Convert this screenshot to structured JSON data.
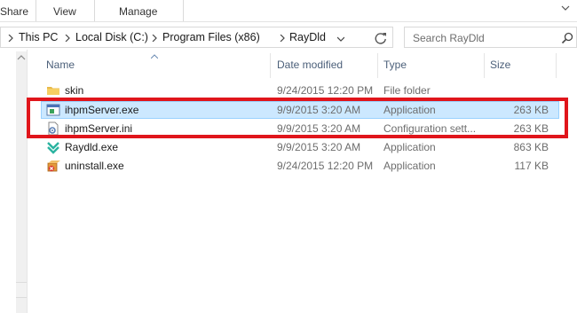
{
  "ribbon": {
    "tabs": [
      "Share",
      "View",
      "Manage"
    ]
  },
  "address": {
    "crumbs": [
      "This PC",
      "Local Disk (C:)",
      "Program Files (x86)",
      "RayDld"
    ]
  },
  "search": {
    "placeholder": "Search RayDld"
  },
  "columns": {
    "name": "Name",
    "date": "Date modified",
    "type": "Type",
    "size": "Size"
  },
  "files": [
    {
      "name": "skin",
      "date": "9/24/2015 12:20 PM",
      "type": "File folder",
      "size": "",
      "icon": "folder-icon"
    },
    {
      "name": "ihpmServer.exe",
      "date": "9/9/2015 3:20 AM",
      "type": "Application",
      "size": "263 KB",
      "icon": "exe-window-icon"
    },
    {
      "name": "ihpmServer.ini",
      "date": "9/9/2015 3:20 AM",
      "type": "Configuration sett...",
      "size": "263 KB",
      "icon": "config-file-icon"
    },
    {
      "name": "Raydld.exe",
      "date": "9/9/2015 3:20 AM",
      "type": "Application",
      "size": "863 KB",
      "icon": "raydld-app-icon"
    },
    {
      "name": "uninstall.exe",
      "date": "9/24/2015 12:20 PM",
      "type": "Application",
      "size": "117 KB",
      "icon": "uninstall-icon"
    }
  ],
  "colors": {
    "selection_fill": "#cce8ff",
    "selection_border": "#99d1ff",
    "annotation": "#e0151b",
    "header_text": "#4c607a"
  }
}
